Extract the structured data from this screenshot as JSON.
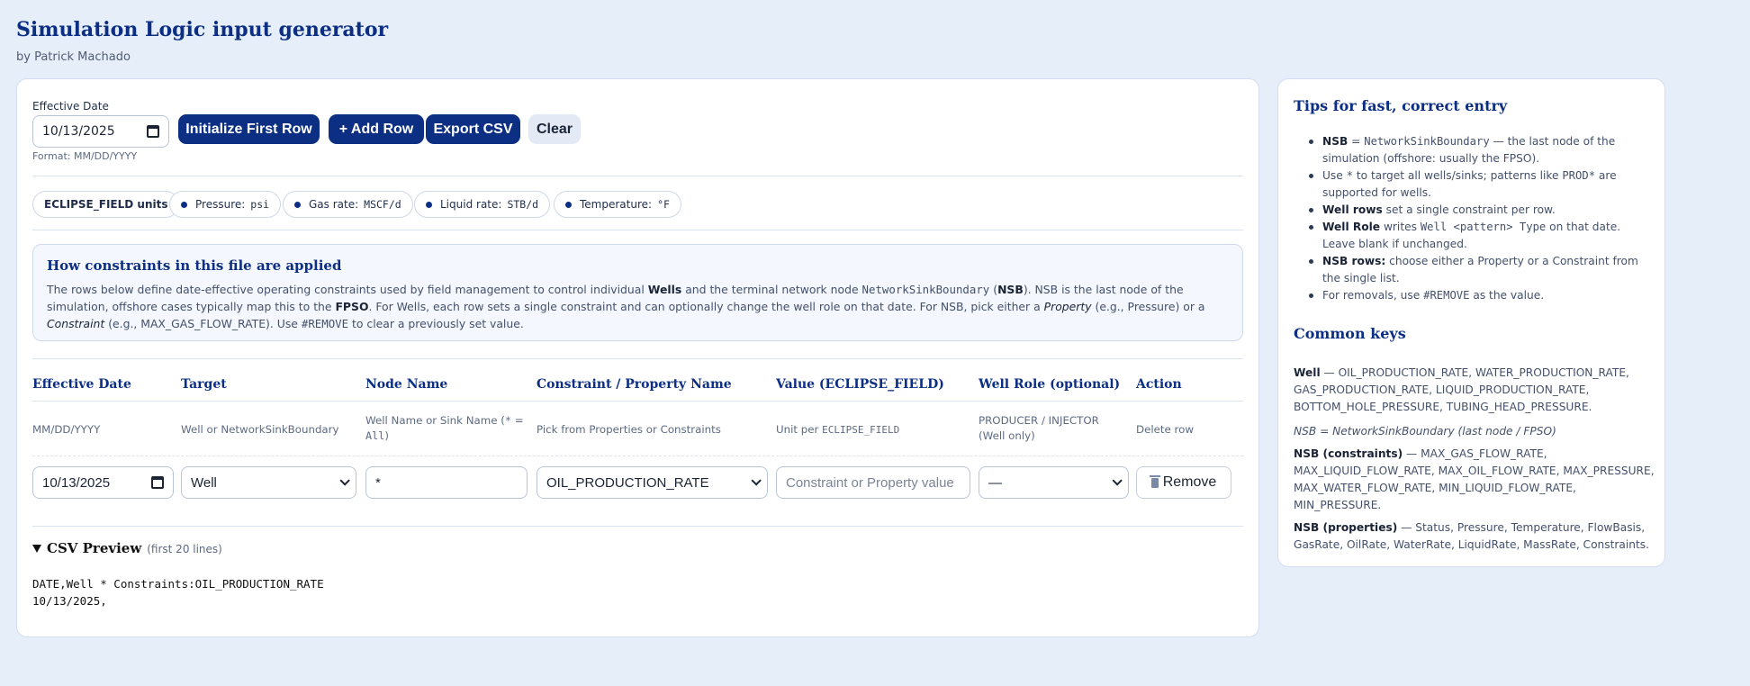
{
  "header": {
    "title": "Simulation Logic input generator",
    "byline": "by Patrick Machado"
  },
  "toolbar": {
    "date_label": "Effective Date",
    "date_value": "10/13/2025",
    "date_hint": "Format: MM/DD/YYYY",
    "init_label": "Initialize First Row",
    "add_label": "+ Add Row",
    "export_label": "Export CSV",
    "clear_label": "Clear"
  },
  "units": {
    "field_label": "ECLIPSE_FIELD units",
    "items": [
      {
        "label": "Pressure:",
        "value": "psi"
      },
      {
        "label": "Gas rate:",
        "value": "MSCF/d"
      },
      {
        "label": "Liquid rate:",
        "value": "STB/d"
      },
      {
        "label": "Temperature:",
        "value": "°F"
      }
    ]
  },
  "info": {
    "title": "How constraints in this file are applied",
    "p1": "The rows below define date-effective operating constraints used by field management to control individual ",
    "wells": "Wells",
    "p2": " and the terminal network node ",
    "nsb_code": "NetworkSinkBoundary",
    "p3": " (",
    "nsb": "NSB",
    "p4": "). NSB is the last node of the simulation, offshore cases typically map this to the ",
    "fpso": "FPSO",
    "p5": ". For Wells, each row sets a single constraint and can optionally change the well role on that date. For NSB, pick either a ",
    "property": "Property",
    "p6": " (e.g., Pressure) or a ",
    "constraint": "Constraint",
    "p7": " (e.g., MAX_GAS_FLOW_RATE). Use ",
    "remove_code": "#REMOVE",
    "p8": " to clear a previously set value."
  },
  "table": {
    "headers": [
      "Effective Date",
      "Target",
      "Node Name",
      "Constraint / Property Name",
      "Value (ECLIPSE_FIELD)",
      "Well Role (optional)",
      "Action"
    ],
    "hints": {
      "date": "MM/DD/YYYY",
      "target": "Well or NetworkSinkBoundary",
      "node_a": "Well Name or Sink Name (",
      "node_code_a": "*",
      "node_b": " =",
      "node_code_b": "All",
      "node_c": ")",
      "constraint": "Pick from Properties or Constraints",
      "value_a": "Unit per ",
      "value_code": "ECLIPSE_FIELD",
      "role_a": "PRODUCER / INJECTOR",
      "role_b": "(Well only)",
      "action": "Delete row"
    },
    "row": {
      "date": "10/13/2025",
      "target": "Well",
      "node": "*",
      "constraint": "OIL_PRODUCTION_RATE",
      "value_placeholder": "Constraint or Property value",
      "role": "—",
      "remove_label": "Remove"
    }
  },
  "csv": {
    "title": "CSV Preview",
    "subtitle": "(first 20 lines)",
    "line1": "DATE,Well * Constraints:OIL_PRODUCTION_RATE",
    "line2": "10/13/2025,"
  },
  "tips": {
    "title": "Tips for fast, correct entry",
    "t1_b": "NSB",
    "t1_a": " = ",
    "t1_code": "NetworkSinkBoundary",
    "t1_c": " — the last node of the simulation (offshore: usually the FPSO).",
    "t2_a": "Use ",
    "t2_code": "*",
    "t2_b": " to target all wells/sinks; patterns like ",
    "t2_code2": "PROD*",
    "t2_c": " are supported for wells.",
    "t3_b": "Well rows",
    "t3_a": " set a single constraint per row.",
    "t4_b": "Well Role",
    "t4_a": " writes ",
    "t4_code": "Well <pattern> Type",
    "t4_c": " on that date. Leave blank if unchanged.",
    "t5_b": "NSB rows:",
    "t5_a": " choose either a Property or a Constraint from the single list.",
    "t6_a": "For removals, use ",
    "t6_code": "#REMOVE",
    "t6_b": " as the value."
  },
  "common": {
    "title": "Common keys",
    "well_b": "Well",
    "well_a": " — OIL_PRODUCTION_RATE, WATER_PRODUCTION_RATE, GAS_PRODUCTION_RATE, LIQUID_PRODUCTION_RATE, BOTTOM_HOLE_PRESSURE, TUBING_HEAD_PRESSURE.",
    "nsb_note": "NSB = NetworkSinkBoundary (last node / FPSO)",
    "nsbc_b": "NSB (constraints)",
    "nsbc_a": " — MAX_GAS_FLOW_RATE, MAX_LIQUID_FLOW_RATE, MAX_OIL_FLOW_RATE, MAX_PRESSURE, MAX_WATER_FLOW_RATE, MIN_LIQUID_FLOW_RATE, MIN_PRESSURE.",
    "nsbp_b": "NSB (properties)",
    "nsbp_a": " — Status, Pressure, Temperature, FlowBasis, GasRate, OilRate, WaterRate, LiquidRate, MassRate, Constraints."
  }
}
